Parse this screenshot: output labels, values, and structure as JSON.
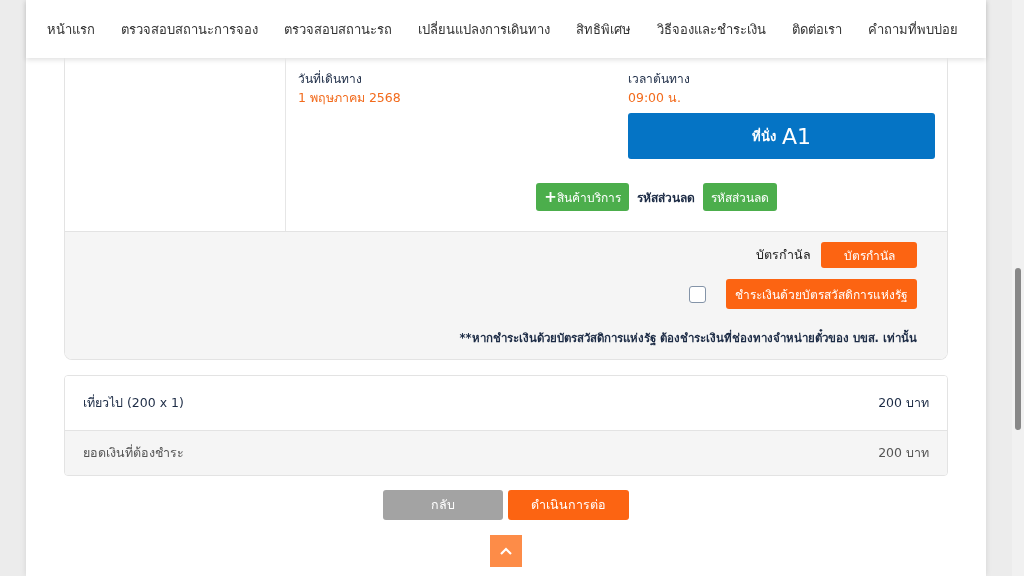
{
  "nav": {
    "items": [
      {
        "label": "หน้าแรก"
      },
      {
        "label": "ตรวจสอบสถานะการจอง"
      },
      {
        "label": "ตรวจสอบสถานะรถ"
      },
      {
        "label": "เปลี่ยนแปลงการเดินทาง"
      },
      {
        "label": "สิทธิพิเศษ"
      },
      {
        "label": "วิธีจองและชำระเงิน"
      },
      {
        "label": "ติดต่อเรา"
      },
      {
        "label": "คำถามที่พบบ่อย"
      }
    ]
  },
  "trip": {
    "date_label": "วันที่เดินทาง",
    "date": "1 พฤษภาคม 2568",
    "time_label": "เวลาต้นทาง",
    "time": "09:00 น.",
    "seat_label": "ที่นั่ง",
    "seat": "A1",
    "services_button": "สินค้าบริการ",
    "services_icon": "+",
    "discount_label": "รหัสส่วนลด",
    "discount_button": "รหัสส่วนลด"
  },
  "payment": {
    "card_label": "บัตรกำนัล",
    "card_button": "บัตรกำนัล",
    "welfare_checked": false,
    "welfare_button": "ชำระเงินด้วยบัตรสวัสดิการแห่งรัฐ",
    "note": "**หากชำระเงินด้วยบัตรสวัสดิการแห่งรัฐ ต้องชำระเงินที่ช่องทางจำหน่ายตั๋วของ บขส. เท่านั้น"
  },
  "summary": [
    {
      "label": "เที่ยวไป (200 x 1)",
      "amount": "200 บาท",
      "kind": "line"
    },
    {
      "label": "ยอดเงินที่ต้องชำระ",
      "amount": "200 บาท",
      "kind": "total"
    }
  ],
  "buttons": {
    "back": "กลับ",
    "next": "ดำเนินการต่อ"
  }
}
